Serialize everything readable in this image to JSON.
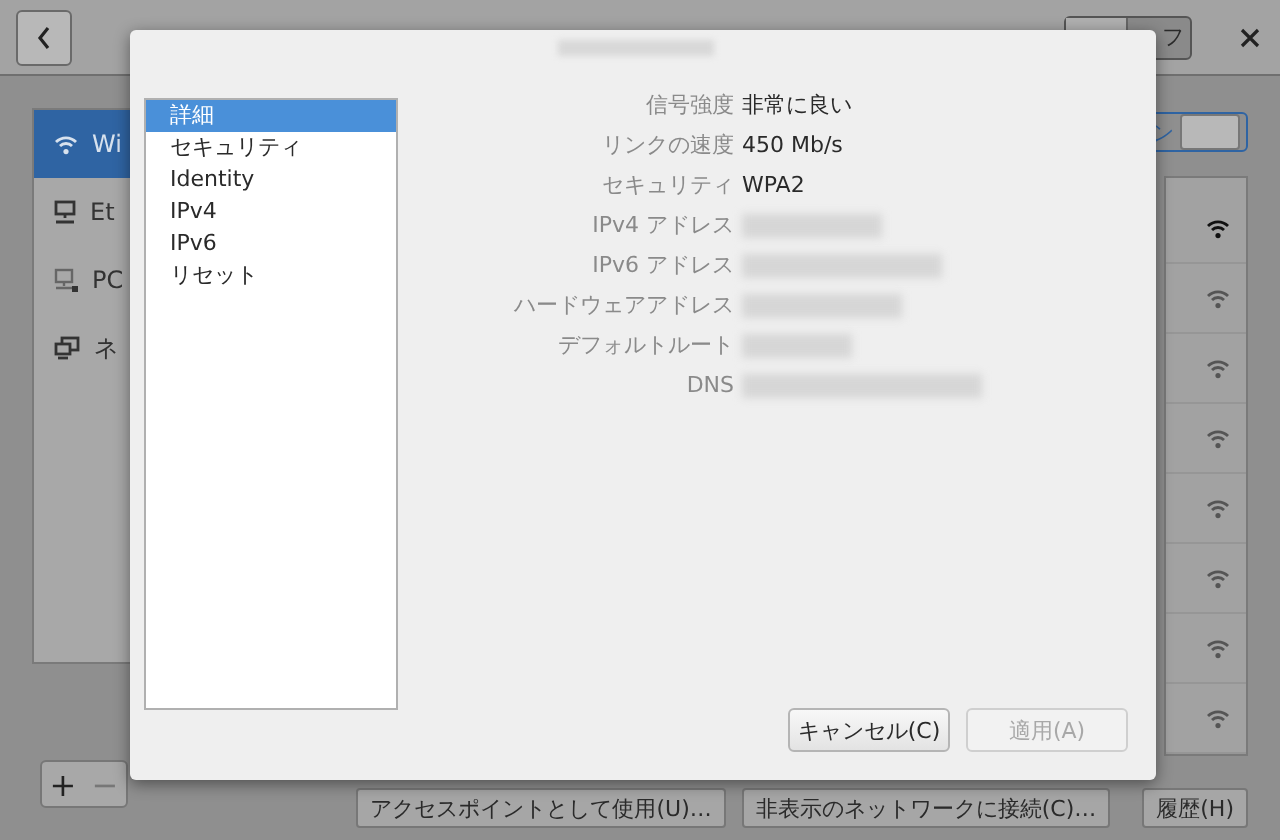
{
  "background": {
    "header_toggle": {
      "label": "フ",
      "on": false
    },
    "sidebar_items": [
      {
        "label": "Wi",
        "kind": "wifi",
        "selected": true
      },
      {
        "label": "Et",
        "kind": "wired",
        "selected": false
      },
      {
        "label": "PC",
        "kind": "pc",
        "selected": false
      },
      {
        "label": "ネ",
        "kind": "network",
        "selected": false
      }
    ],
    "wifi_switch": {
      "label": "ン",
      "on": true
    },
    "network_rows": [
      {
        "connected": true
      },
      {
        "connected": false
      },
      {
        "connected": false
      },
      {
        "connected": false
      },
      {
        "connected": false
      },
      {
        "connected": false
      },
      {
        "connected": false
      },
      {
        "connected": false
      }
    ],
    "list_buttons": [
      {
        "label": "+",
        "disabled": false
      },
      {
        "label": "−",
        "disabled": true
      }
    ],
    "buttons": [
      "アクセスポイントとして使用(U)…",
      "非表示のネットワークに接続(C)…",
      "履歴(H)"
    ]
  },
  "dialog": {
    "sections": [
      {
        "label": "詳細",
        "selected": true
      },
      {
        "label": "セキュリティ",
        "selected": false
      },
      {
        "label": "Identity",
        "selected": false
      },
      {
        "label": "IPv4",
        "selected": false
      },
      {
        "label": "IPv6",
        "selected": false
      },
      {
        "label": "リセット",
        "selected": false
      }
    ],
    "details": [
      {
        "label": "信号強度",
        "value": "非常に良い",
        "redacted": false
      },
      {
        "label": "リンクの速度",
        "value": "450 Mb/s",
        "redacted": false
      },
      {
        "label": "セキュリティ",
        "value": "WPA2",
        "redacted": false
      },
      {
        "label": "IPv4 アドレス",
        "redacted": true
      },
      {
        "label": "IPv6 アドレス",
        "redacted": true
      },
      {
        "label": "ハードウェアアドレス",
        "redacted": true
      },
      {
        "label": "デフォルトルート",
        "redacted": true
      },
      {
        "label": "DNS",
        "redacted": true
      }
    ],
    "buttons": [
      {
        "label": "キャンセル(C)",
        "disabled": false
      },
      {
        "label": "適用(A)",
        "disabled": true
      }
    ]
  }
}
